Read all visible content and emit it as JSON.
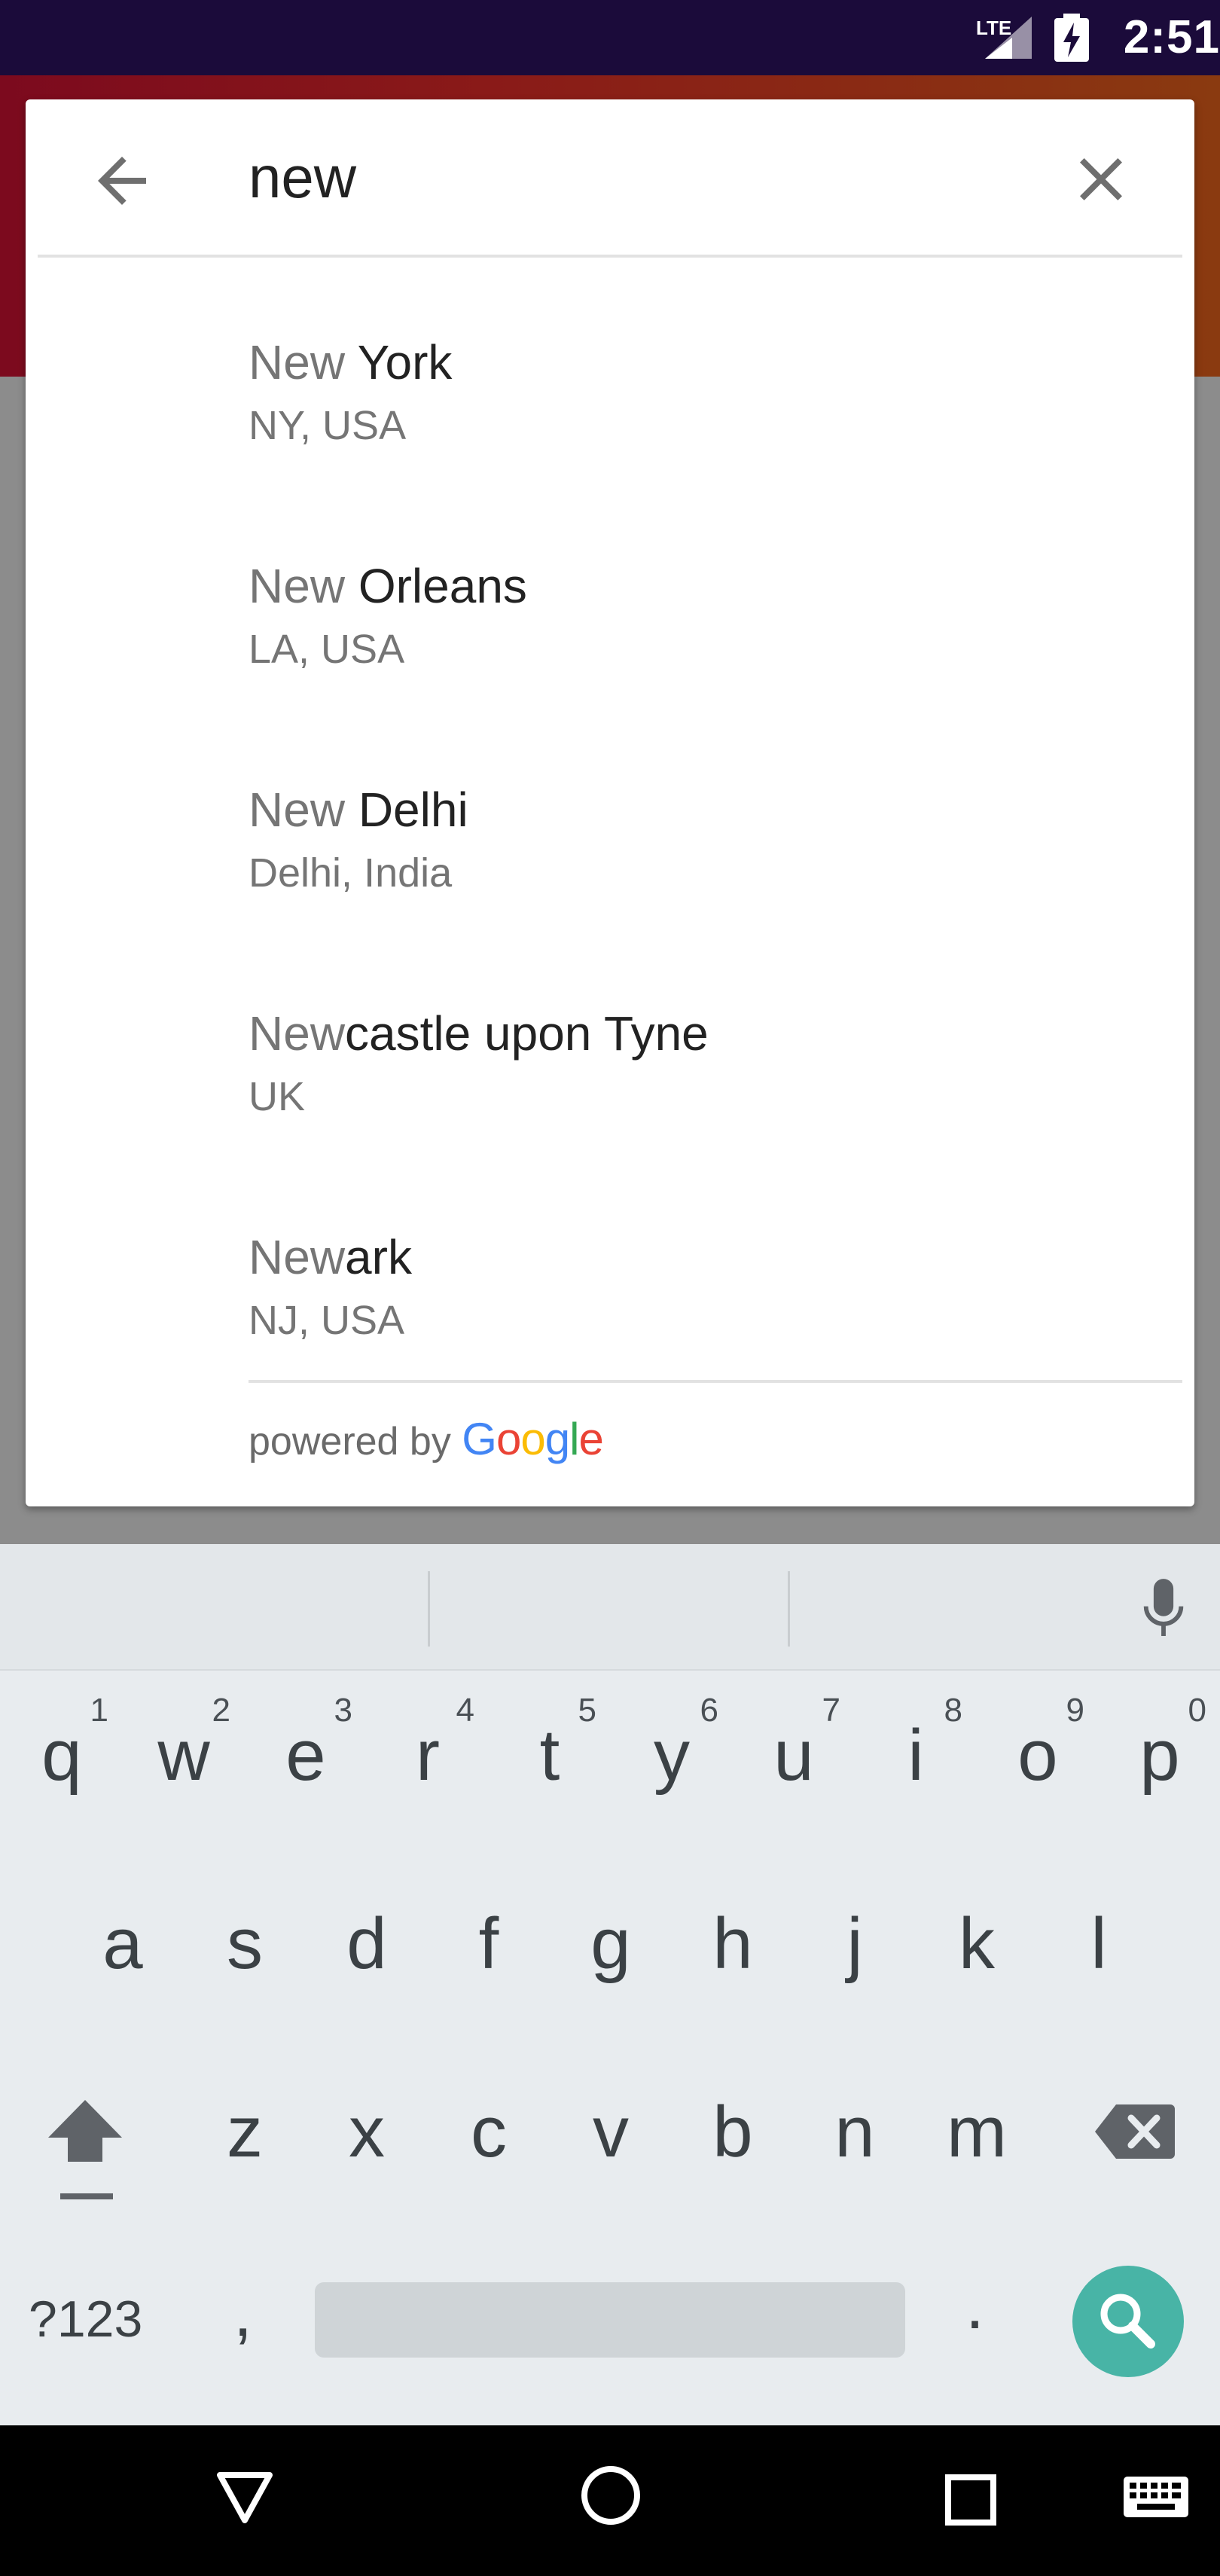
{
  "status_bar": {
    "network": "LTE",
    "time": "2:51"
  },
  "search": {
    "query": "new"
  },
  "results": [
    {
      "match": "New",
      "rest": " York",
      "secondary": "NY, USA"
    },
    {
      "match": "New",
      "rest": " Orleans",
      "secondary": "LA, USA"
    },
    {
      "match": "New",
      "rest": " Delhi",
      "secondary": "Delhi, India"
    },
    {
      "match": "New",
      "rest": "castle upon Tyne",
      "secondary": "UK"
    },
    {
      "match": "New",
      "rest": "ark",
      "secondary": "NJ, USA"
    }
  ],
  "attribution": {
    "prefix": "powered by",
    "brand": [
      "G",
      "o",
      "o",
      "g",
      "l",
      "e"
    ]
  },
  "keyboard": {
    "row1": [
      {
        "char": "q",
        "num": "1"
      },
      {
        "char": "w",
        "num": "2"
      },
      {
        "char": "e",
        "num": "3"
      },
      {
        "char": "r",
        "num": "4"
      },
      {
        "char": "t",
        "num": "5"
      },
      {
        "char": "y",
        "num": "6"
      },
      {
        "char": "u",
        "num": "7"
      },
      {
        "char": "i",
        "num": "8"
      },
      {
        "char": "o",
        "num": "9"
      },
      {
        "char": "p",
        "num": "0"
      }
    ],
    "row2": [
      "a",
      "s",
      "d",
      "f",
      "g",
      "h",
      "j",
      "k",
      "l"
    ],
    "row3": [
      "z",
      "x",
      "c",
      "v",
      "b",
      "n",
      "m"
    ],
    "symbols_label": "?123",
    "comma": ",",
    "period": "."
  },
  "colors": {
    "accent": "#48b4a6",
    "status_bar": "#1b0b3a",
    "app_bar_start": "#7c0a1e",
    "app_bar_end": "#8a3a10"
  },
  "icons": {
    "back": "arrow-left-icon",
    "clear": "close-icon",
    "mic": "microphone-icon",
    "shift": "shift-icon",
    "backspace": "backspace-icon",
    "search": "search-icon",
    "nav_back": "triangle-back-icon",
    "nav_home": "circle-home-icon",
    "nav_recent": "square-recent-icon",
    "nav_keyboard": "keyboard-icon"
  }
}
